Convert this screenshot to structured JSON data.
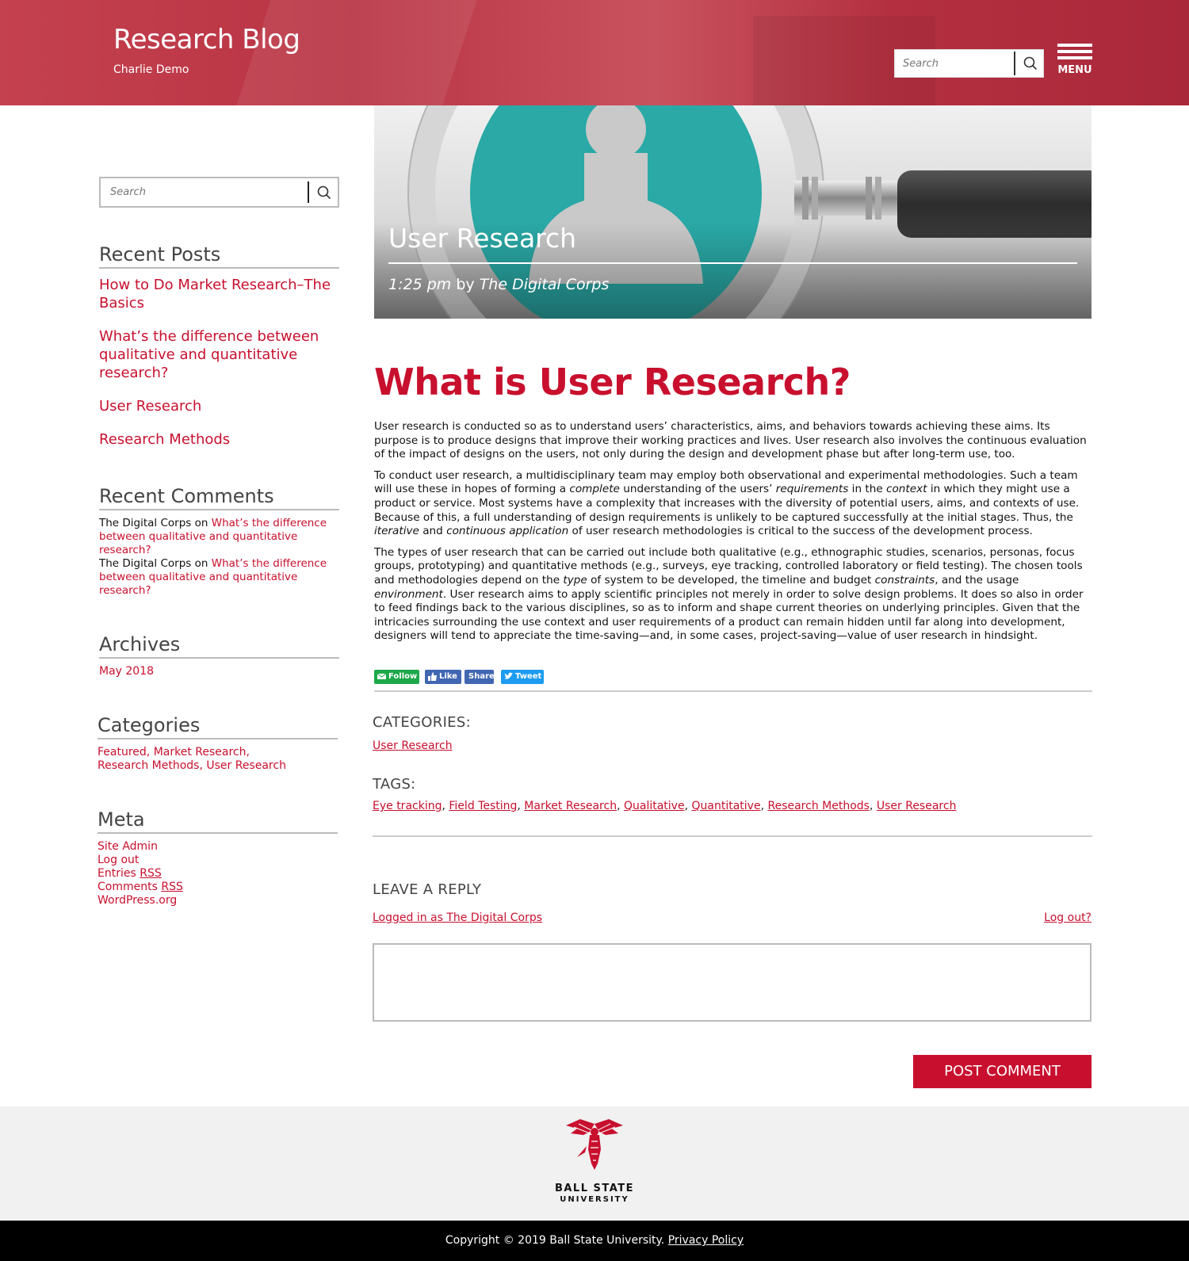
{
  "header": {
    "site_title": "Research Blog",
    "site_subtitle": "Charlie Demo",
    "search_placeholder": "Search",
    "menu_label": "MENU",
    "brand_color": "#c8102e"
  },
  "sidebar": {
    "search_placeholder": "Search",
    "recent_posts_title": "Recent Posts",
    "recent_posts": [
      "How to Do Market Research–The Basics",
      "What’s the difference between qualitative and quantitative research?",
      "User Research",
      "Research Methods"
    ],
    "recent_comments_title": "Recent Comments",
    "recent_comments": [
      {
        "author": "The Digital Corps",
        "on": "on",
        "post": "What’s the difference between qualitative and quantitative research?"
      },
      {
        "author": "The Digital Corps",
        "on": "on",
        "post": "What’s the difference between qualitative and quantitative research?"
      }
    ],
    "archives_title": "Archives",
    "archives": [
      "May 2018"
    ],
    "categories_title": "Categories",
    "categories_line1": "Featured, Market Research,",
    "categories_line2": "Research Methods, User Research",
    "meta_title": "Meta",
    "meta": [
      "Site Admin",
      "Log out",
      "Entries",
      "Comments",
      "WordPress.org"
    ],
    "rss": "RSS"
  },
  "hero": {
    "title": "User Research",
    "time": "1:25 pm",
    "by": "by",
    "author": "The Digital Corps"
  },
  "article": {
    "title": "What is User Research?",
    "p1": "User research is conducted so as to understand users’ characteristics, aims, and behaviors towards achieving these aims. Its purpose is to produce designs that improve their working practices and lives. User research also involves the continuous evaluation of the impact of designs on the users, not only during the design and development phase but after long-term use, too.",
    "p2_a": "To conduct user research, a multidisciplinary team may employ both observational and experimental methodologies. Such a team will use these in hopes of forming a ",
    "p2_em1": "complete",
    "p2_b": " understanding of the users’ ",
    "p2_em2": "requirements",
    "p2_c": " in the ",
    "p2_em3": "context",
    "p2_d": " in which they might use a product or service. Most systems have a complexity that increases with the diversity of potential users, aims, and contexts of use. Because of this, a full understanding of design requirements is unlikely to be captured successfully at the initial stages. Thus, the ",
    "p2_em4": "iterative",
    "p2_e": " and ",
    "p2_em5": "continuous application",
    "p2_f": " of user research methodologies is critical to the success of the development process.",
    "p3_a": "The types of user research that can be carried out include both qualitative (e.g., ethnographic studies, scenarios, personas, focus groups, prototyping) and quantitative methods (e.g., surveys, eye tracking, controlled laboratory or field testing). The chosen tools and methodologies depend on the ",
    "p3_em1": "type",
    "p3_b": " of system to be developed, the timeline and budget ",
    "p3_em2": "constraints",
    "p3_c": ", and the usage ",
    "p3_em3": "environment",
    "p3_d": ". User research aims to apply scientific principles not merely in order to solve design problems. It does so also in order to feed findings back to the various disciplines, so as to inform and shape current theories on underlying principles. Given that the intricacies surrounding the use context and user requirements of a product can remain hidden until far along into development, designers will tend to appreciate the time-saving—and, in some cases, project-saving—value of user research in hindsight."
  },
  "share": {
    "follow": "Follow",
    "like": "Like",
    "share": "Share",
    "tweet": "Tweet"
  },
  "post_meta": {
    "categories_label": "CATEGORIES:",
    "categories": [
      "User Research"
    ],
    "tags_label": "TAGS:",
    "tags": [
      "Eye tracking",
      "Field Testing",
      "Market Research",
      "Qualitative",
      "Quantitative",
      "Research Methods",
      "User Research"
    ]
  },
  "reply": {
    "title": "LEAVE A REPLY",
    "logged_in": "Logged in as The Digital Corps",
    "logout": "Log out?",
    "submit": "POST COMMENT"
  },
  "footer": {
    "university_line1": "BALL STATE",
    "university_line2": "UNIVERSITY",
    "copyright": "Copyright © 2019 Ball State University.",
    "privacy": "Privacy Policy"
  }
}
